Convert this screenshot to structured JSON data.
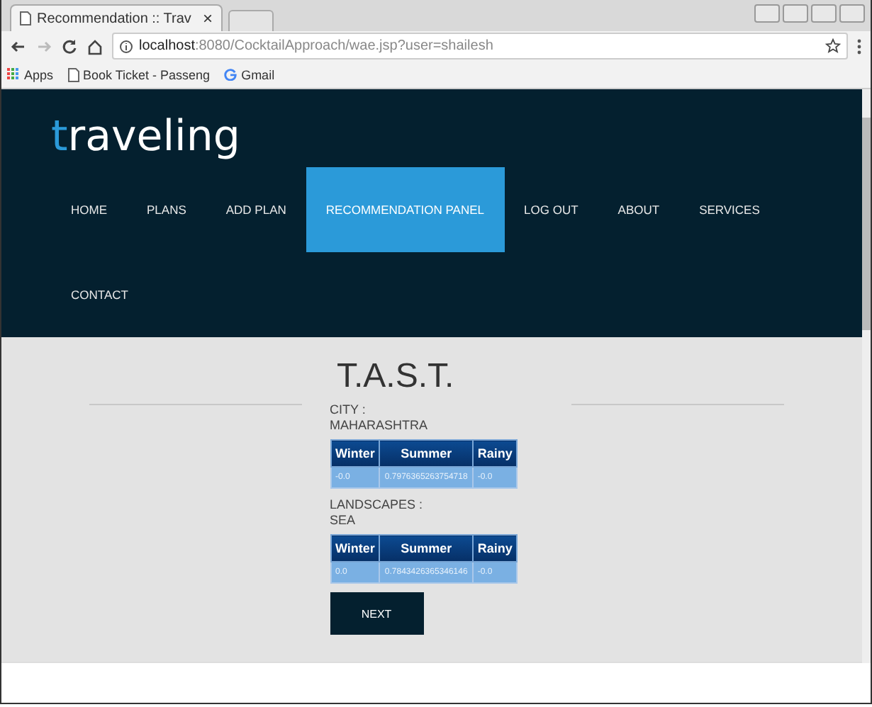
{
  "browser": {
    "tab_title": "Recommendation :: Trav",
    "tab_close": "×",
    "url_host": "localhost",
    "url_rest": ":8080/CocktailApproach/wae.jsp?user=shailesh",
    "bookmarks": [
      {
        "kind": "apps",
        "label": "Apps"
      },
      {
        "kind": "page",
        "label": "Book Ticket - Passeng"
      },
      {
        "kind": "google",
        "label": "Gmail"
      }
    ]
  },
  "site": {
    "logo": "traveling",
    "nav": [
      {
        "label": "HOME",
        "selected": false
      },
      {
        "label": "PLANS",
        "selected": false
      },
      {
        "label": "ADD PLAN",
        "selected": false
      },
      {
        "label": "RECOMMENDATION PANEL",
        "selected": true
      },
      {
        "label": "LOG OUT",
        "selected": false
      },
      {
        "label": "ABOUT",
        "selected": false
      },
      {
        "label": "SERVICES",
        "selected": false
      },
      {
        "label": "CONTACT",
        "selected": false
      }
    ]
  },
  "content": {
    "title": "T.A.S.T.",
    "sections": [
      {
        "label": "CITY :",
        "value": "MAHARASHTRA",
        "columns": [
          "Winter",
          "Summer",
          "Rainy"
        ],
        "row": [
          "-0.0",
          "0.7976365263754718",
          "-0.0"
        ]
      },
      {
        "label": "LANDSCAPES :",
        "value": "SEA",
        "columns": [
          "Winter",
          "Summer",
          "Rainy"
        ],
        "row": [
          "0.0",
          "0.7843426365346146",
          "-0.0"
        ]
      }
    ],
    "button": "NEXT"
  }
}
